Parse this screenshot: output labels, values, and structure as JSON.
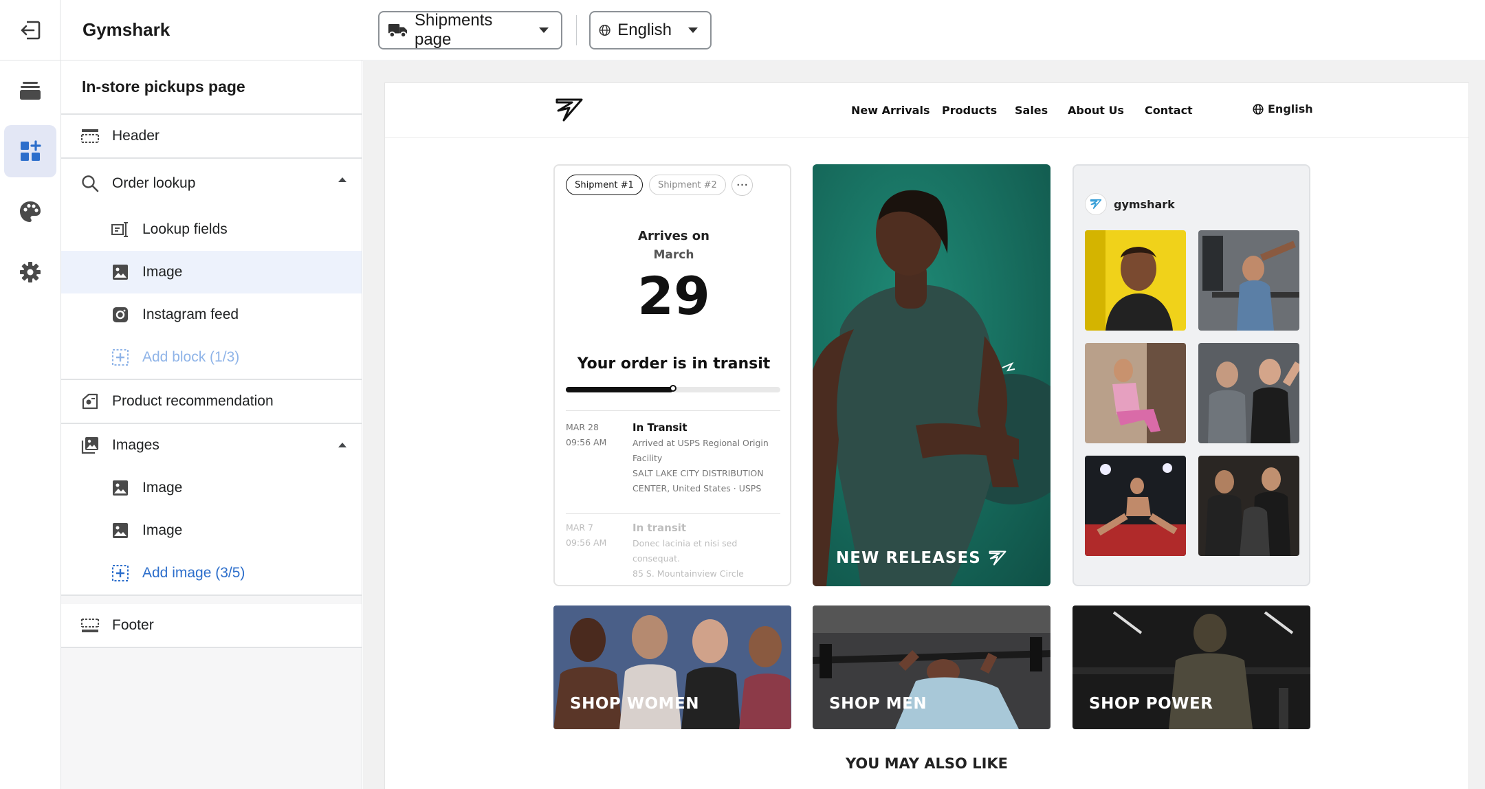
{
  "app": {
    "title": "Gymshark"
  },
  "topbar": {
    "page_select": {
      "label": "Shipments page",
      "icon": "truck-icon"
    },
    "lang_select": {
      "label": "English",
      "icon": "globe-icon"
    }
  },
  "rail": {
    "items": [
      "exit-icon",
      "layers-icon",
      "add-block-icon",
      "palette-icon",
      "gear-icon"
    ],
    "active_color": "#e3e7f5"
  },
  "sidebar": {
    "title": "In-store pickups page",
    "header": "Header",
    "order_lookup": {
      "label": "Order lookup",
      "children": [
        "Lookup fields",
        "Image",
        "Instagram feed"
      ],
      "add": "Add block (1/3)"
    },
    "product_recommendation": "Product recommendation",
    "images": {
      "label": "Images",
      "children": [
        "Image",
        "Image"
      ],
      "add": "Add image (3/5)"
    },
    "footer": "Footer",
    "accent": "#2c6ecb",
    "selected_bg": "#edf2fc"
  },
  "store": {
    "nav": [
      "New Arrivals",
      "Products",
      "Sales",
      "About Us",
      "Contact"
    ],
    "lang": "English"
  },
  "shipment": {
    "tabs": [
      "Shipment #1",
      "Shipment #2"
    ],
    "more": "···",
    "arrives_on": "Arrives on",
    "month": "March",
    "day": "29",
    "status": "Your order is in transit",
    "progress": 0.5,
    "events": [
      {
        "date": "MAR 28",
        "time": "09:56 AM",
        "title": "In Transit",
        "lines": [
          "Arrived at USPS Regional Origin",
          "Facility",
          "SALT LAKE CITY DISTRIBUTION",
          "CENTER, United States · USPS"
        ]
      },
      {
        "date": "MAR 7",
        "time": "09:56 AM",
        "title": "In transit",
        "lines": [
          "Donec lacinia et nisi sed",
          "consequat.",
          "85 S. Mountainview Circle"
        ]
      }
    ]
  },
  "hero": {
    "title": "NEW RELEASES"
  },
  "instagram": {
    "handle": "gymshark"
  },
  "shop_tiles": [
    "SHOP WOMEN",
    "SHOP MEN",
    "SHOP POWER"
  ],
  "also_like": "YOU MAY ALSO LIKE"
}
